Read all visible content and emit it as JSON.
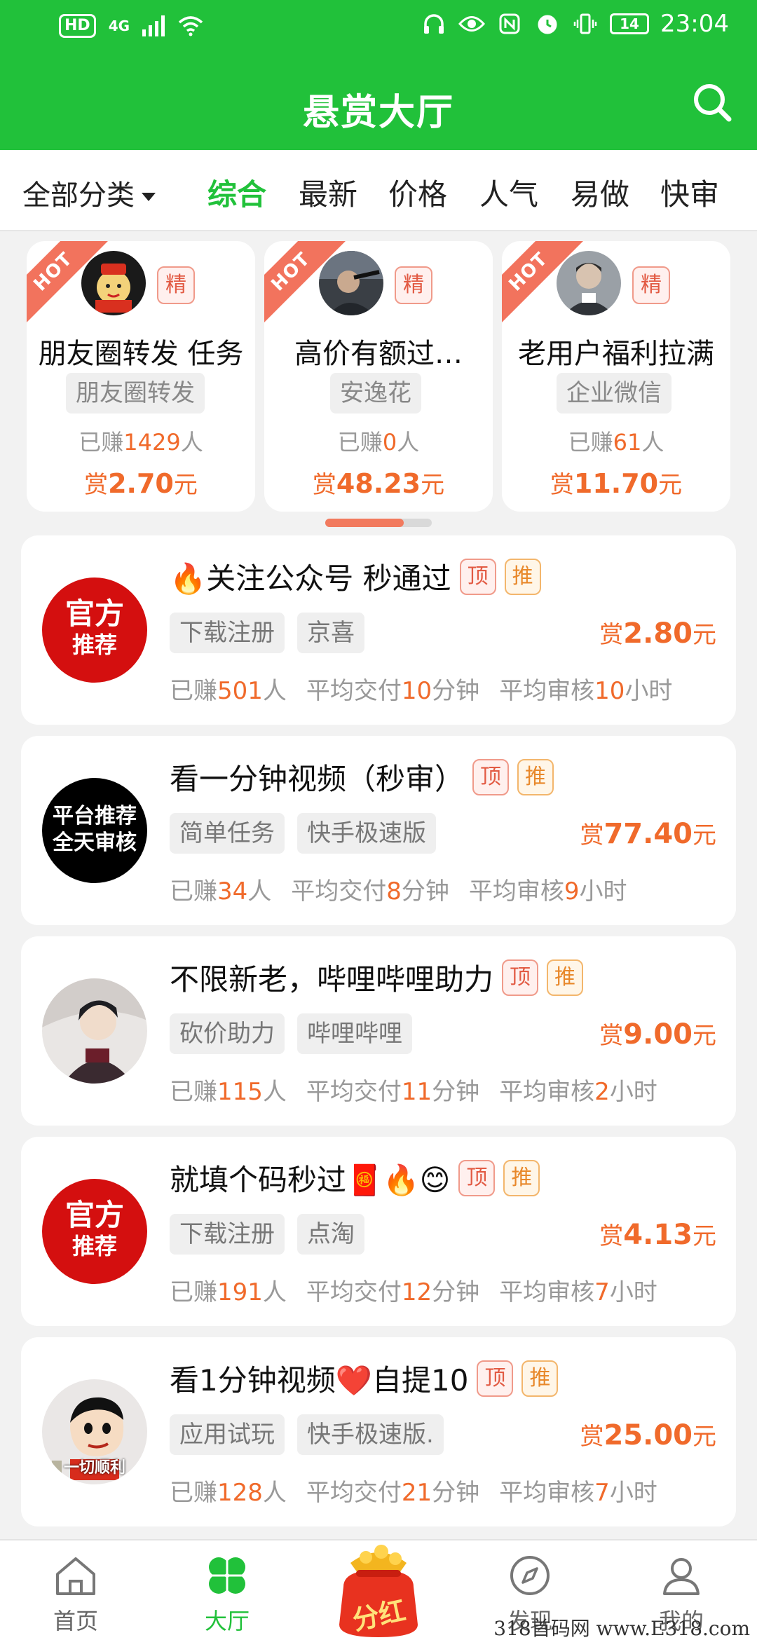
{
  "status_bar": {
    "hd": "HD",
    "network": "4G",
    "battery": "14",
    "time": "23:04"
  },
  "header": {
    "title": "悬赏大厅"
  },
  "category_tabs": {
    "all_label": "全部分类",
    "tabs": [
      "综合",
      "最新",
      "价格",
      "人气",
      "易做",
      "快审"
    ],
    "active_index": 0
  },
  "hot_cards": [
    {
      "ribbon": "HOT",
      "badge": "精",
      "name": "朋友圈转发 任务",
      "tag": "朋友圈转发",
      "earned_prefix": "已赚",
      "earned": "1429",
      "earned_suffix": "人",
      "price_prefix": "赏",
      "price": "2.70",
      "price_suffix": "元"
    },
    {
      "ribbon": "HOT",
      "badge": "精",
      "name": "高价有额过…",
      "tag": "安逸花",
      "earned_prefix": "已赚",
      "earned": "0",
      "earned_suffix": "人",
      "price_prefix": "赏",
      "price": "48.23",
      "price_suffix": "元"
    },
    {
      "ribbon": "HOT",
      "badge": "精",
      "name": "老用户福利拉满",
      "tag": "企业微信",
      "earned_prefix": "已赚",
      "earned": "61",
      "earned_suffix": "人",
      "price_prefix": "赏",
      "price": "11.70",
      "price_suffix": "元"
    }
  ],
  "tasks": [
    {
      "avatar_text": [
        "官方",
        "推荐"
      ],
      "title": "🔥关注公众号 秒通过",
      "badge_top": "顶",
      "badge_rec": "推",
      "tags": [
        "下载注册",
        "京喜"
      ],
      "price_prefix": "赏",
      "price": "2.80",
      "price_suffix": "元",
      "earned_prefix": "已赚",
      "earned": "501",
      "earned_suffix": "人",
      "deliver_prefix": "平均交付",
      "deliver": "10",
      "deliver_suffix": "分钟",
      "review_prefix": "平均审核",
      "review": "10",
      "review_suffix": "小时"
    },
    {
      "avatar_text": [
        "平台推荐",
        "全天审核"
      ],
      "title": "看一分钟视频（秒审）",
      "badge_top": "顶",
      "badge_rec": "推",
      "tags": [
        "简单任务",
        "快手极速版"
      ],
      "price_prefix": "赏",
      "price": "77.40",
      "price_suffix": "元",
      "earned_prefix": "已赚",
      "earned": "34",
      "earned_suffix": "人",
      "deliver_prefix": "平均交付",
      "deliver": "8",
      "deliver_suffix": "分钟",
      "review_prefix": "平均审核",
      "review": "9",
      "review_suffix": "小时"
    },
    {
      "avatar_text": [
        "",
        ""
      ],
      "title": "不限新老，哔哩哔哩助力",
      "badge_top": "顶",
      "badge_rec": "推",
      "tags": [
        "砍价助力",
        "哔哩哔哩"
      ],
      "price_prefix": "赏",
      "price": "9.00",
      "price_suffix": "元",
      "earned_prefix": "已赚",
      "earned": "115",
      "earned_suffix": "人",
      "deliver_prefix": "平均交付",
      "deliver": "11",
      "deliver_suffix": "分钟",
      "review_prefix": "平均审核",
      "review": "2",
      "review_suffix": "小时"
    },
    {
      "avatar_text": [
        "官方",
        "推荐"
      ],
      "title": "就填个码秒过🧧🔥😊",
      "badge_top": "顶",
      "badge_rec": "推",
      "tags": [
        "下载注册",
        "点淘"
      ],
      "price_prefix": "赏",
      "price": "4.13",
      "price_suffix": "元",
      "earned_prefix": "已赚",
      "earned": "191",
      "earned_suffix": "人",
      "deliver_prefix": "平均交付",
      "deliver": "12",
      "deliver_suffix": "分钟",
      "review_prefix": "平均审核",
      "review": "7",
      "review_suffix": "小时"
    },
    {
      "avatar_text": [
        "一切顺利",
        ""
      ],
      "title": "看1分钟视频❤️自提10",
      "badge_top": "顶",
      "badge_rec": "推",
      "tags": [
        "应用试玩",
        "快手极速版."
      ],
      "price_prefix": "赏",
      "price": "25.00",
      "price_suffix": "元",
      "earned_prefix": "已赚",
      "earned": "128",
      "earned_suffix": "人",
      "deliver_prefix": "平均交付",
      "deliver": "21",
      "deliver_suffix": "分钟",
      "review_prefix": "平均审核",
      "review": "7",
      "review_suffix": "小时"
    }
  ],
  "bottom_nav": {
    "items": [
      "首页",
      "大厅",
      "分红",
      "发现",
      "我的"
    ],
    "active_index": 1
  },
  "watermark": "318首码网 www.E318.com",
  "colors": {
    "brand_green": "#21c13a",
    "price_orange": "#f06a2b",
    "hot_red": "#f2735d"
  }
}
